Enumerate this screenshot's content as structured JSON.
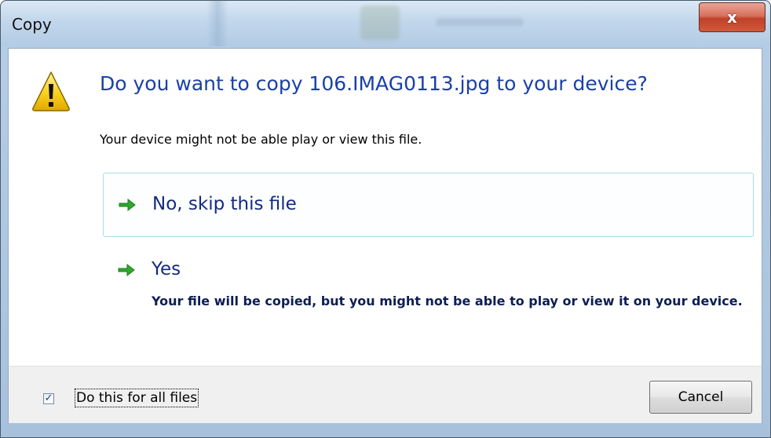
{
  "window": {
    "title": "Copy",
    "close_label": "x"
  },
  "dialog": {
    "icon": "warning-icon",
    "heading": "Do you want to copy 106.IMAG0113.jpg to your device?",
    "description": "Your device might not be able play or view this file.",
    "options": [
      {
        "icon": "green-arrow-icon",
        "title": "No, skip this file",
        "subtitle": ""
      },
      {
        "icon": "green-arrow-icon",
        "title": "Yes",
        "subtitle": "Your file will be copied, but you might not be able to play or view it on your device."
      }
    ]
  },
  "footer": {
    "checkbox_checked": true,
    "checkbox_label": "Do this for all files",
    "cancel_label": "Cancel"
  },
  "colors": {
    "heading": "#1a40a8",
    "option_border": "#a8dde9",
    "arrow": "#2fa82f",
    "close_button": "#c1412b"
  }
}
